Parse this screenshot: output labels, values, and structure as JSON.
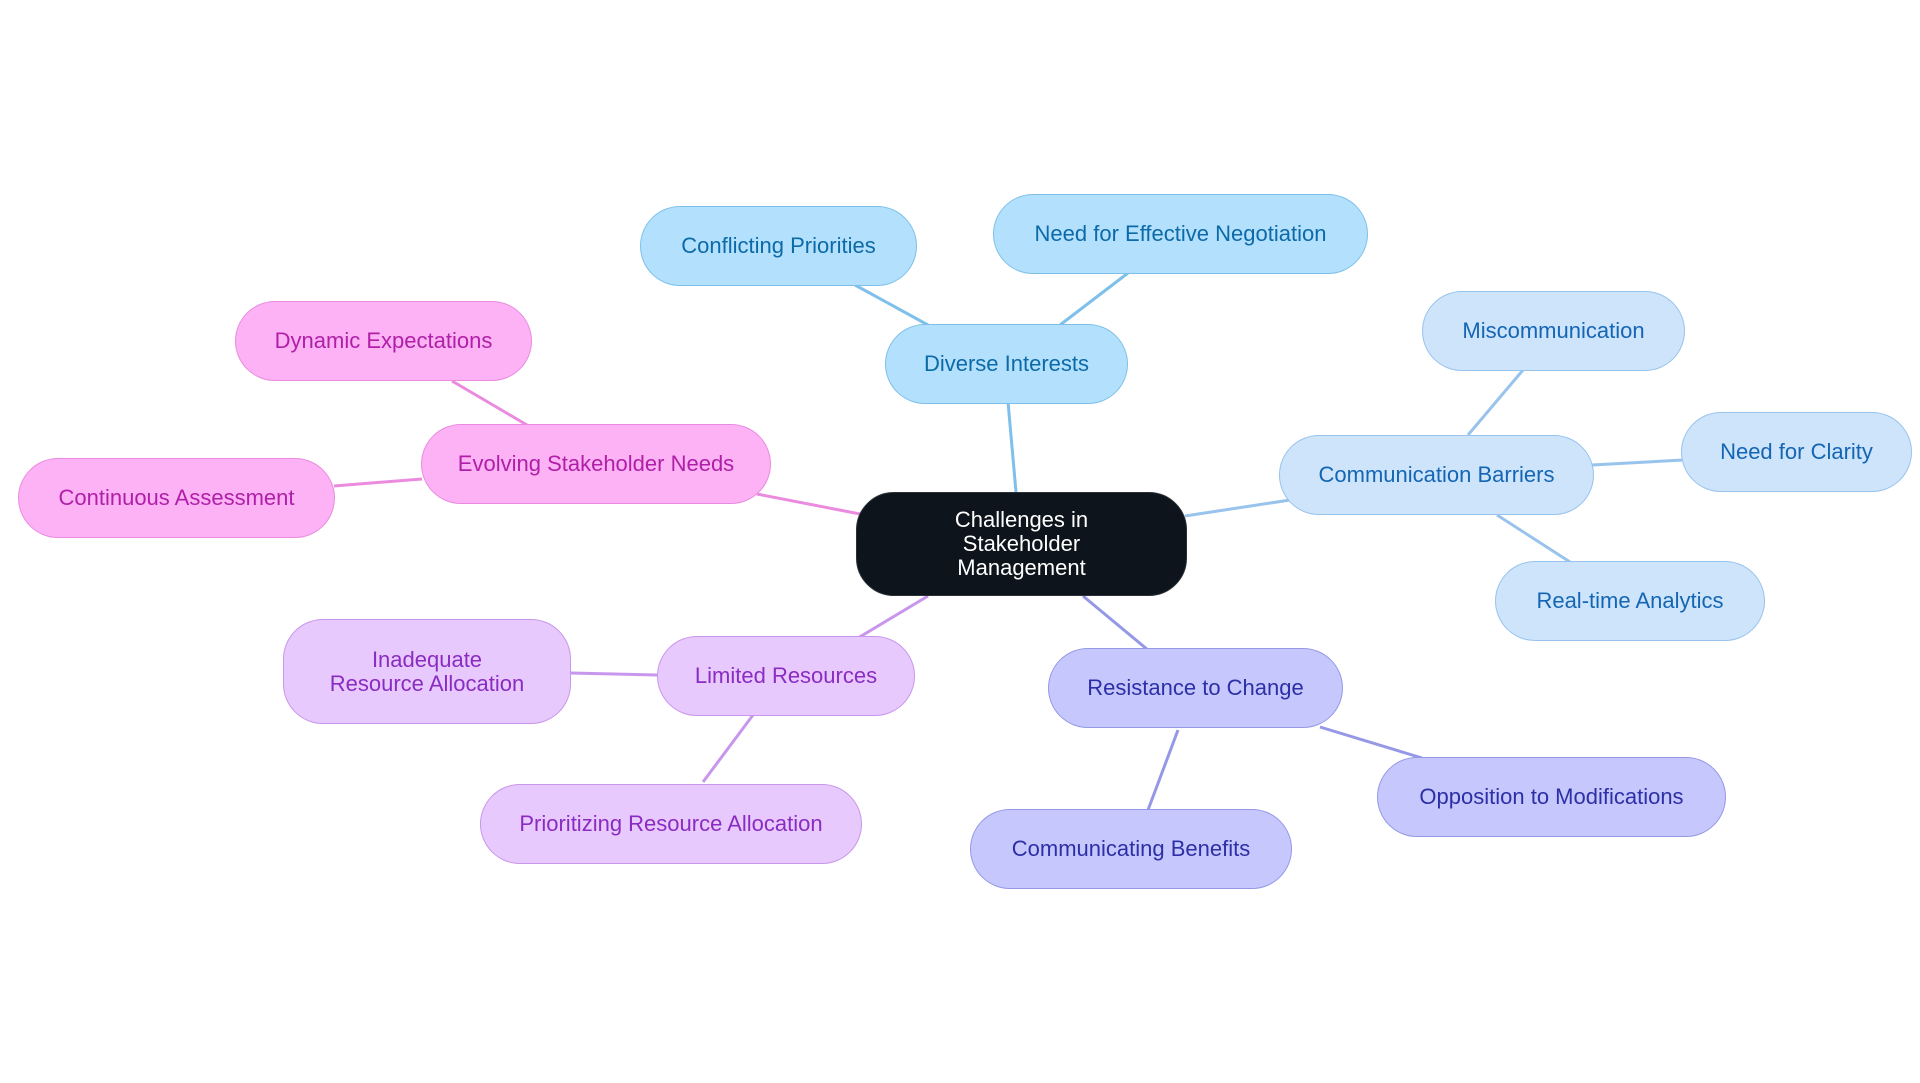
{
  "root": {
    "label": "Challenges in Stakeholder Management"
  },
  "branches": [
    {
      "key": "diverse",
      "label": "Diverse Interests",
      "color": "#7ec0ea",
      "children": [
        {
          "label": "Conflicting Priorities"
        },
        {
          "label": "Need for Effective Negotiation"
        }
      ]
    },
    {
      "key": "comm",
      "label": "Communication Barriers",
      "color": "#98c3ec",
      "children": [
        {
          "label": "Miscommunication"
        },
        {
          "label": "Need for Clarity"
        },
        {
          "label": "Real-time Analytics"
        }
      ]
    },
    {
      "key": "resist",
      "label": "Resistance to Change",
      "color": "#9498e6",
      "children": [
        {
          "label": "Opposition to Modifications"
        },
        {
          "label": "Communicating Benefits"
        }
      ]
    },
    {
      "key": "limited",
      "label": "Limited Resources",
      "color": "#c896ec",
      "children": [
        {
          "label": "Inadequate Resource Allocation"
        },
        {
          "label": "Prioritizing Resource Allocation"
        }
      ]
    },
    {
      "key": "evolving",
      "label": "Evolving Stakeholder Needs",
      "color": "#ea8be0",
      "children": [
        {
          "label": "Dynamic Expectations"
        },
        {
          "label": "Continuous Assessment"
        }
      ]
    }
  ]
}
